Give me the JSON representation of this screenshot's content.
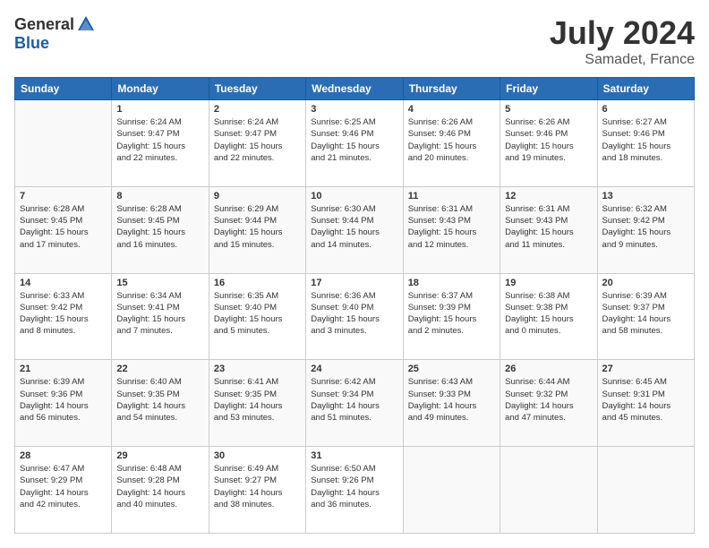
{
  "header": {
    "logo_general": "General",
    "logo_blue": "Blue",
    "month_year": "July 2024",
    "location": "Samadet, France"
  },
  "calendar": {
    "days_of_week": [
      "Sunday",
      "Monday",
      "Tuesday",
      "Wednesday",
      "Thursday",
      "Friday",
      "Saturday"
    ],
    "weeks": [
      [
        {
          "day": "",
          "info": ""
        },
        {
          "day": "1",
          "info": "Sunrise: 6:24 AM\nSunset: 9:47 PM\nDaylight: 15 hours\nand 22 minutes."
        },
        {
          "day": "2",
          "info": "Sunrise: 6:24 AM\nSunset: 9:47 PM\nDaylight: 15 hours\nand 22 minutes."
        },
        {
          "day": "3",
          "info": "Sunrise: 6:25 AM\nSunset: 9:46 PM\nDaylight: 15 hours\nand 21 minutes."
        },
        {
          "day": "4",
          "info": "Sunrise: 6:26 AM\nSunset: 9:46 PM\nDaylight: 15 hours\nand 20 minutes."
        },
        {
          "day": "5",
          "info": "Sunrise: 6:26 AM\nSunset: 9:46 PM\nDaylight: 15 hours\nand 19 minutes."
        },
        {
          "day": "6",
          "info": "Sunrise: 6:27 AM\nSunset: 9:46 PM\nDaylight: 15 hours\nand 18 minutes."
        }
      ],
      [
        {
          "day": "7",
          "info": "Sunrise: 6:28 AM\nSunset: 9:45 PM\nDaylight: 15 hours\nand 17 minutes."
        },
        {
          "day": "8",
          "info": "Sunrise: 6:28 AM\nSunset: 9:45 PM\nDaylight: 15 hours\nand 16 minutes."
        },
        {
          "day": "9",
          "info": "Sunrise: 6:29 AM\nSunset: 9:44 PM\nDaylight: 15 hours\nand 15 minutes."
        },
        {
          "day": "10",
          "info": "Sunrise: 6:30 AM\nSunset: 9:44 PM\nDaylight: 15 hours\nand 14 minutes."
        },
        {
          "day": "11",
          "info": "Sunrise: 6:31 AM\nSunset: 9:43 PM\nDaylight: 15 hours\nand 12 minutes."
        },
        {
          "day": "12",
          "info": "Sunrise: 6:31 AM\nSunset: 9:43 PM\nDaylight: 15 hours\nand 11 minutes."
        },
        {
          "day": "13",
          "info": "Sunrise: 6:32 AM\nSunset: 9:42 PM\nDaylight: 15 hours\nand 9 minutes."
        }
      ],
      [
        {
          "day": "14",
          "info": "Sunrise: 6:33 AM\nSunset: 9:42 PM\nDaylight: 15 hours\nand 8 minutes."
        },
        {
          "day": "15",
          "info": "Sunrise: 6:34 AM\nSunset: 9:41 PM\nDaylight: 15 hours\nand 7 minutes."
        },
        {
          "day": "16",
          "info": "Sunrise: 6:35 AM\nSunset: 9:40 PM\nDaylight: 15 hours\nand 5 minutes."
        },
        {
          "day": "17",
          "info": "Sunrise: 6:36 AM\nSunset: 9:40 PM\nDaylight: 15 hours\nand 3 minutes."
        },
        {
          "day": "18",
          "info": "Sunrise: 6:37 AM\nSunset: 9:39 PM\nDaylight: 15 hours\nand 2 minutes."
        },
        {
          "day": "19",
          "info": "Sunrise: 6:38 AM\nSunset: 9:38 PM\nDaylight: 15 hours\nand 0 minutes."
        },
        {
          "day": "20",
          "info": "Sunrise: 6:39 AM\nSunset: 9:37 PM\nDaylight: 14 hours\nand 58 minutes."
        }
      ],
      [
        {
          "day": "21",
          "info": "Sunrise: 6:39 AM\nSunset: 9:36 PM\nDaylight: 14 hours\nand 56 minutes."
        },
        {
          "day": "22",
          "info": "Sunrise: 6:40 AM\nSunset: 9:35 PM\nDaylight: 14 hours\nand 54 minutes."
        },
        {
          "day": "23",
          "info": "Sunrise: 6:41 AM\nSunset: 9:35 PM\nDaylight: 14 hours\nand 53 minutes."
        },
        {
          "day": "24",
          "info": "Sunrise: 6:42 AM\nSunset: 9:34 PM\nDaylight: 14 hours\nand 51 minutes."
        },
        {
          "day": "25",
          "info": "Sunrise: 6:43 AM\nSunset: 9:33 PM\nDaylight: 14 hours\nand 49 minutes."
        },
        {
          "day": "26",
          "info": "Sunrise: 6:44 AM\nSunset: 9:32 PM\nDaylight: 14 hours\nand 47 minutes."
        },
        {
          "day": "27",
          "info": "Sunrise: 6:45 AM\nSunset: 9:31 PM\nDaylight: 14 hours\nand 45 minutes."
        }
      ],
      [
        {
          "day": "28",
          "info": "Sunrise: 6:47 AM\nSunset: 9:29 PM\nDaylight: 14 hours\nand 42 minutes."
        },
        {
          "day": "29",
          "info": "Sunrise: 6:48 AM\nSunset: 9:28 PM\nDaylight: 14 hours\nand 40 minutes."
        },
        {
          "day": "30",
          "info": "Sunrise: 6:49 AM\nSunset: 9:27 PM\nDaylight: 14 hours\nand 38 minutes."
        },
        {
          "day": "31",
          "info": "Sunrise: 6:50 AM\nSunset: 9:26 PM\nDaylight: 14 hours\nand 36 minutes."
        },
        {
          "day": "",
          "info": ""
        },
        {
          "day": "",
          "info": ""
        },
        {
          "day": "",
          "info": ""
        }
      ]
    ]
  }
}
